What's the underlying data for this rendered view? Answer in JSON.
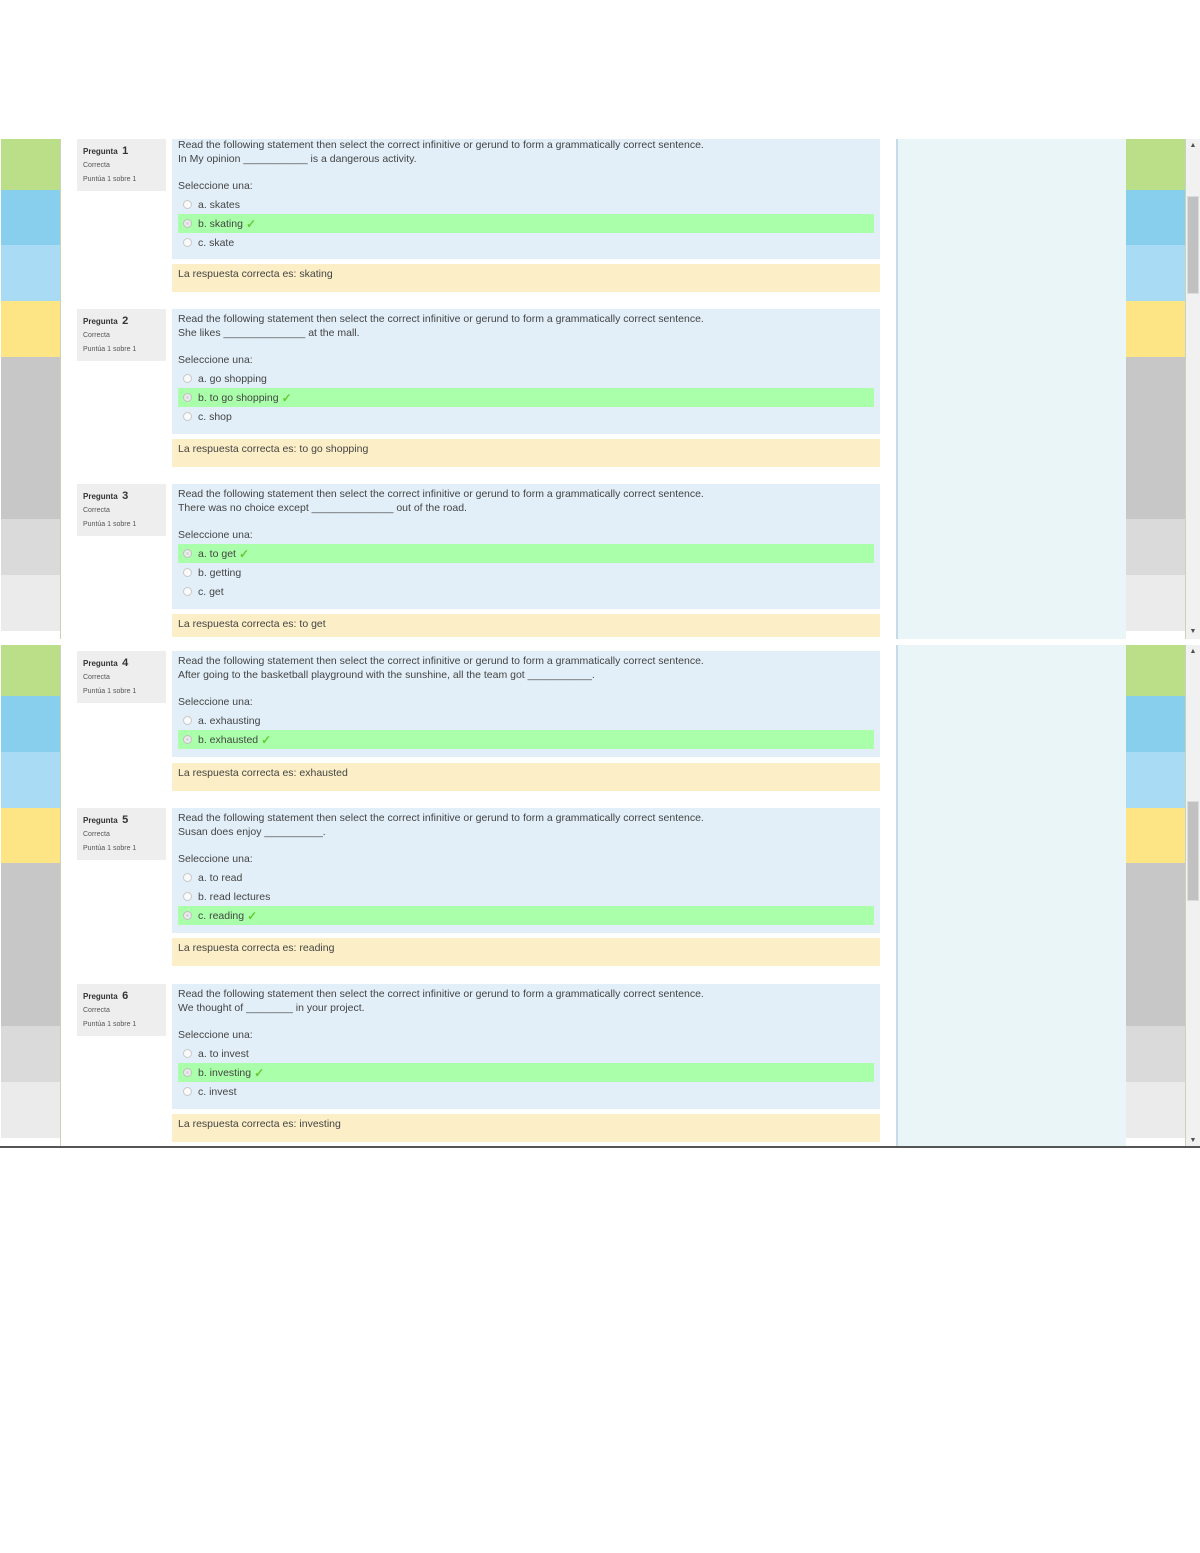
{
  "labels": {
    "question_prefix": "Pregunta",
    "select_prompt": "Seleccione una:",
    "correct_answer_prefix": "La respuesta correcta es: "
  },
  "colors": {
    "strip_bands": [
      "#badf88",
      "#87cfec",
      "#a9dcf4",
      "#fde485",
      "#c7c7c7",
      "#dadada",
      "#ebebeb"
    ],
    "formulation_bg": "#e2eff8",
    "correct_bg": "#aaffaa",
    "outcome_bg": "#fcefc7",
    "info_bg": "#eeeeee",
    "aside_bg": "#eaf5f8",
    "check_color": "#66cc33"
  },
  "questions": [
    {
      "number": "1",
      "state": "Correcta",
      "grade": "Puntúa 1 sobre 1",
      "instruction": "Read the following statement then select the correct infinitive or gerund to form a grammatically correct sentence.",
      "sentence": "In My opinion ___________ is a dangerous activity.",
      "answers": [
        {
          "label": "a. skates",
          "correct": false
        },
        {
          "label": "b. skating",
          "correct": true
        },
        {
          "label": "c. skate",
          "correct": false
        }
      ],
      "right_answer": "La respuesta correcta es: skating"
    },
    {
      "number": "2",
      "state": "Correcta",
      "grade": "Puntúa 1 sobre 1",
      "instruction": "Read the following statement then select the correct infinitive or gerund to form a grammatically correct sentence.",
      "sentence": "She likes ______________ at the mall.",
      "answers": [
        {
          "label": "a. go shopping",
          "correct": false
        },
        {
          "label": "b. to go shopping",
          "correct": true
        },
        {
          "label": "c. shop",
          "correct": false
        }
      ],
      "right_answer": "La respuesta correcta es: to go shopping"
    },
    {
      "number": "3",
      "state": "Correcta",
      "grade": "Puntúa 1 sobre 1",
      "instruction": "Read the following statement then select the correct infinitive or gerund to form a grammatically correct sentence.",
      "sentence": "There was no choice except ______________ out of the road.",
      "answers": [
        {
          "label": "a. to get",
          "correct": true
        },
        {
          "label": "b. getting",
          "correct": false
        },
        {
          "label": "c. get",
          "correct": false
        }
      ],
      "right_answer": "La respuesta correcta es: to get"
    },
    {
      "number": "4",
      "state": "Correcta",
      "grade": "Puntúa 1 sobre 1",
      "instruction": "Read the following statement then select the correct infinitive or gerund to form a grammatically correct sentence.",
      "sentence": "After going to the basketball playground with the sunshine, all the team got ___________.",
      "answers": [
        {
          "label": "a. exhausting",
          "correct": false
        },
        {
          "label": "b. exhausted",
          "correct": true
        }
      ],
      "right_answer": "La respuesta correcta es: exhausted"
    },
    {
      "number": "5",
      "state": "Correcta",
      "grade": "Puntúa 1 sobre 1",
      "instruction": "Read the following statement then select the correct infinitive or gerund to form a grammatically correct sentence.",
      "sentence": "Susan does enjoy __________.",
      "answers": [
        {
          "label": "a. to read",
          "correct": false
        },
        {
          "label": "b. read lectures",
          "correct": false
        },
        {
          "label": "c. reading",
          "correct": true
        }
      ],
      "right_answer": "La respuesta correcta es: reading"
    },
    {
      "number": "6",
      "state": "Correcta",
      "grade": "Puntúa 1 sobre 1",
      "instruction": "Read the following statement then select the correct infinitive or gerund to form a grammatically correct sentence.",
      "sentence": "We thought of ________ in your project.",
      "answers": [
        {
          "label": "a. to invest",
          "correct": false
        },
        {
          "label": "b. investing",
          "correct": true
        },
        {
          "label": "c. invest",
          "correct": false
        }
      ],
      "right_answer": "La respuesta correcta es: investing"
    }
  ],
  "icons": {
    "check": "✓",
    "scroll_up": "▲",
    "scroll_down": "▼"
  }
}
